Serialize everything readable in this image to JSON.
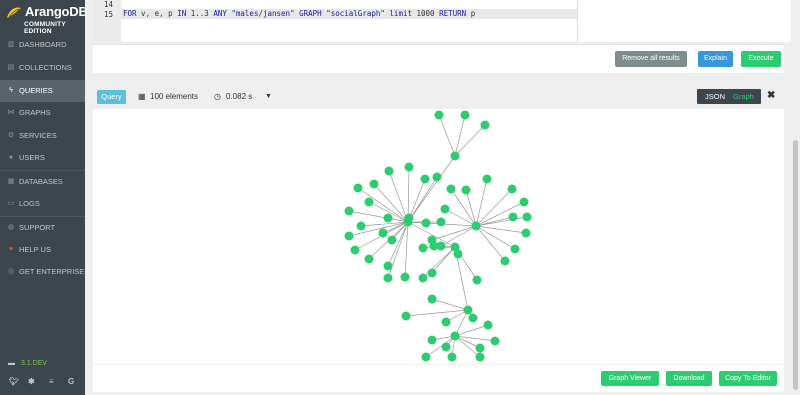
{
  "app": {
    "name": "ArangoDB",
    "edition": "COMMUNITY EDITION"
  },
  "sidebar": {
    "items": [
      {
        "label": "DASHBOARD",
        "icon": "dashboard-icon"
      },
      {
        "label": "COLLECTIONS",
        "icon": "collections-icon"
      },
      {
        "label": "QUERIES",
        "icon": "bolt-icon",
        "active": true
      },
      {
        "label": "GRAPHS",
        "icon": "graph-icon"
      },
      {
        "label": "SERVICES",
        "icon": "services-icon"
      },
      {
        "label": "USERS",
        "icon": "users-icon"
      },
      {
        "label": "DATABASES",
        "icon": "database-icon"
      },
      {
        "label": "LOGS",
        "icon": "logs-icon"
      },
      {
        "label": "SUPPORT",
        "icon": "support-icon"
      },
      {
        "label": "HELP US",
        "icon": "heart-icon"
      },
      {
        "label": "GET ENTERPRISE",
        "icon": "enterprise-icon"
      }
    ],
    "version": "3.1.DEV",
    "social_icons": [
      "twitter-icon",
      "slack-icon",
      "stackoverflow-icon",
      "google-icon"
    ]
  },
  "editor": {
    "lines": [
      {
        "number": "14",
        "text": ""
      },
      {
        "number": "15",
        "text": "FOR v, e, p IN 1..3 ANY \"males/jansen\" GRAPH \"socialGraph\" limit 1000 RETURN p"
      }
    ]
  },
  "actions": {
    "remove_all": "Remove all results",
    "explain": "Explain",
    "execute": "Execute"
  },
  "result": {
    "tag": "Query",
    "elements": "100 elements",
    "time": "0.082 s",
    "view_json": "JSON",
    "view_graph": "Graph",
    "close": "✖",
    "bottom_buttons": {
      "graph_viewer": "Graph Viewer",
      "download": "Download",
      "copy_to_editor": "Copy To Editor"
    }
  },
  "colors": {
    "sidebar_bg": "#3d464d",
    "accent_green": "#2ecc71",
    "query_tag": "#5bc0de",
    "explain_blue": "#3498db",
    "remove_gray": "#7f8c8d",
    "node_green": "#2ecc71",
    "edge_gray": "#9a9a9a"
  }
}
